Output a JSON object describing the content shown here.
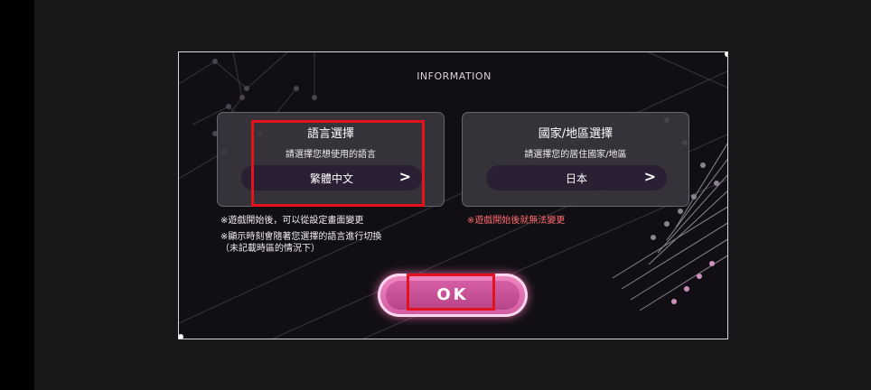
{
  "dialog": {
    "title": "INFORMATION"
  },
  "language_panel": {
    "title": "語言選擇",
    "description": "請選擇您想使用的語言",
    "selected": "繁體中文",
    "chevron": ">"
  },
  "region_panel": {
    "title": "國家/地區選擇",
    "description": "請選擇您的居住國家/地區",
    "selected": "日本",
    "chevron": ">"
  },
  "notes": {
    "language_line1": "※遊戲開始後，可以從設定畫面變更",
    "language_line2": "※顯示時刻會隨著您選擇的語言進行切換",
    "language_line3": "（未記載時區的情況下）",
    "region_warning": "※遊戲開始後就無法變更"
  },
  "ok_button": {
    "label": "OK"
  },
  "colors": {
    "accent_pink": "#e070b5",
    "warning_red": "#ff6b6b",
    "highlight_red": "#e3121c"
  }
}
